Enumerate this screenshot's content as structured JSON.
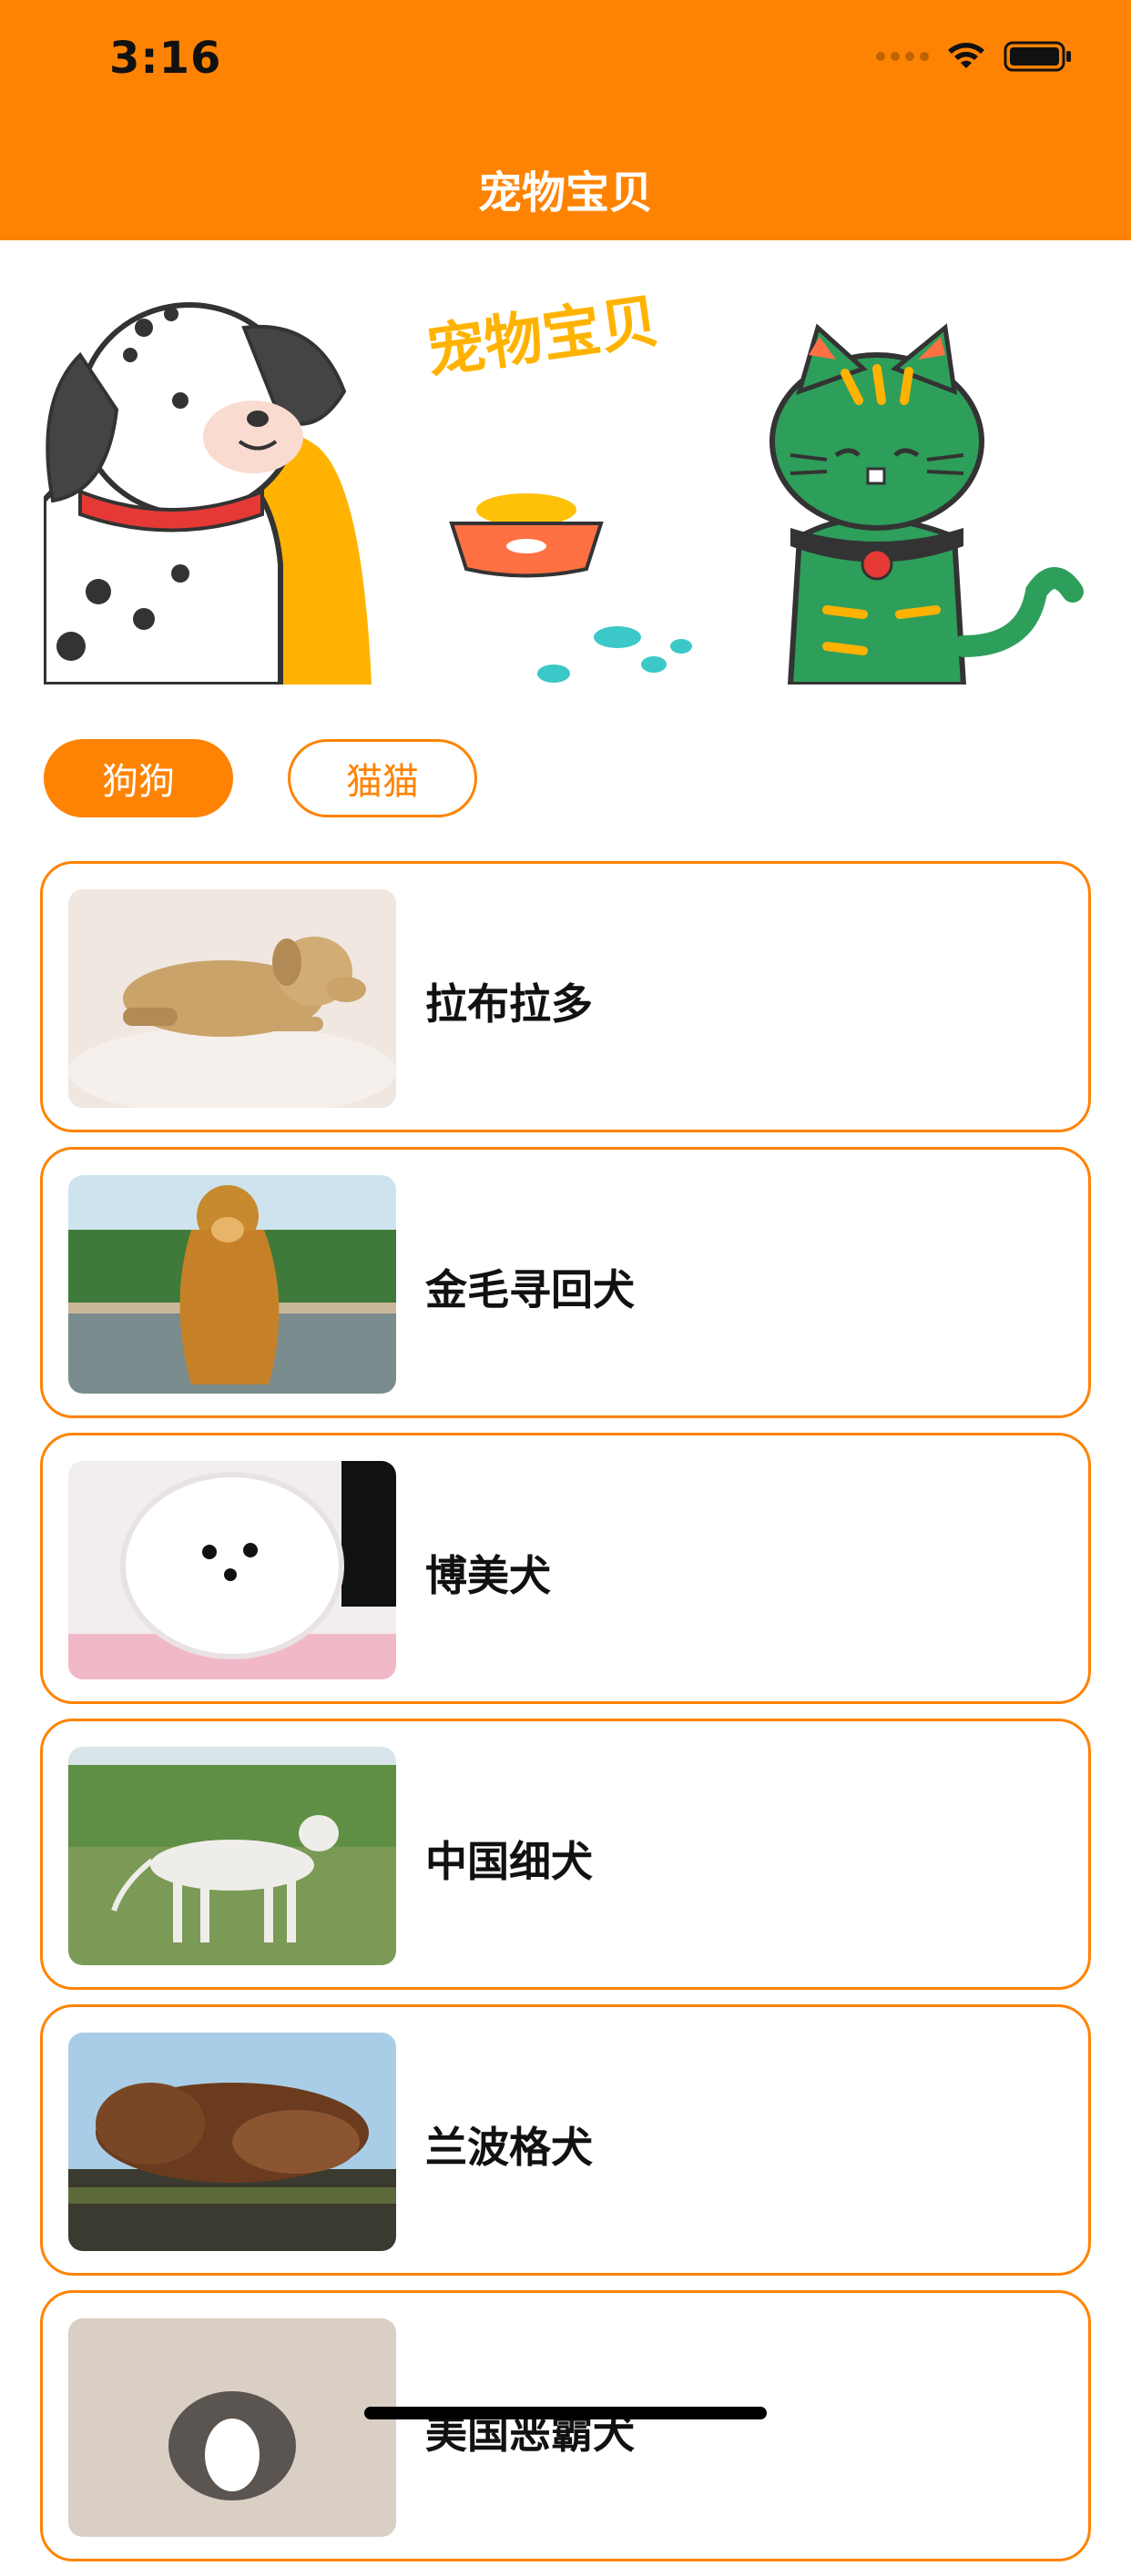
{
  "status_bar": {
    "time": "3:16"
  },
  "nav": {
    "title": "宠物宝贝"
  },
  "banner": {
    "text": "宠物宝贝"
  },
  "tabs": [
    {
      "label": "狗狗",
      "active": true
    },
    {
      "label": "猫猫",
      "active": false
    }
  ],
  "pets": [
    {
      "name": "拉布拉多"
    },
    {
      "name": "金毛寻回犬"
    },
    {
      "name": "博美犬"
    },
    {
      "name": "中国细犬"
    },
    {
      "name": "兰波格犬"
    },
    {
      "name": "美国恶霸犬"
    }
  ],
  "colors": {
    "accent": "#FF8303",
    "text": "#111111"
  }
}
